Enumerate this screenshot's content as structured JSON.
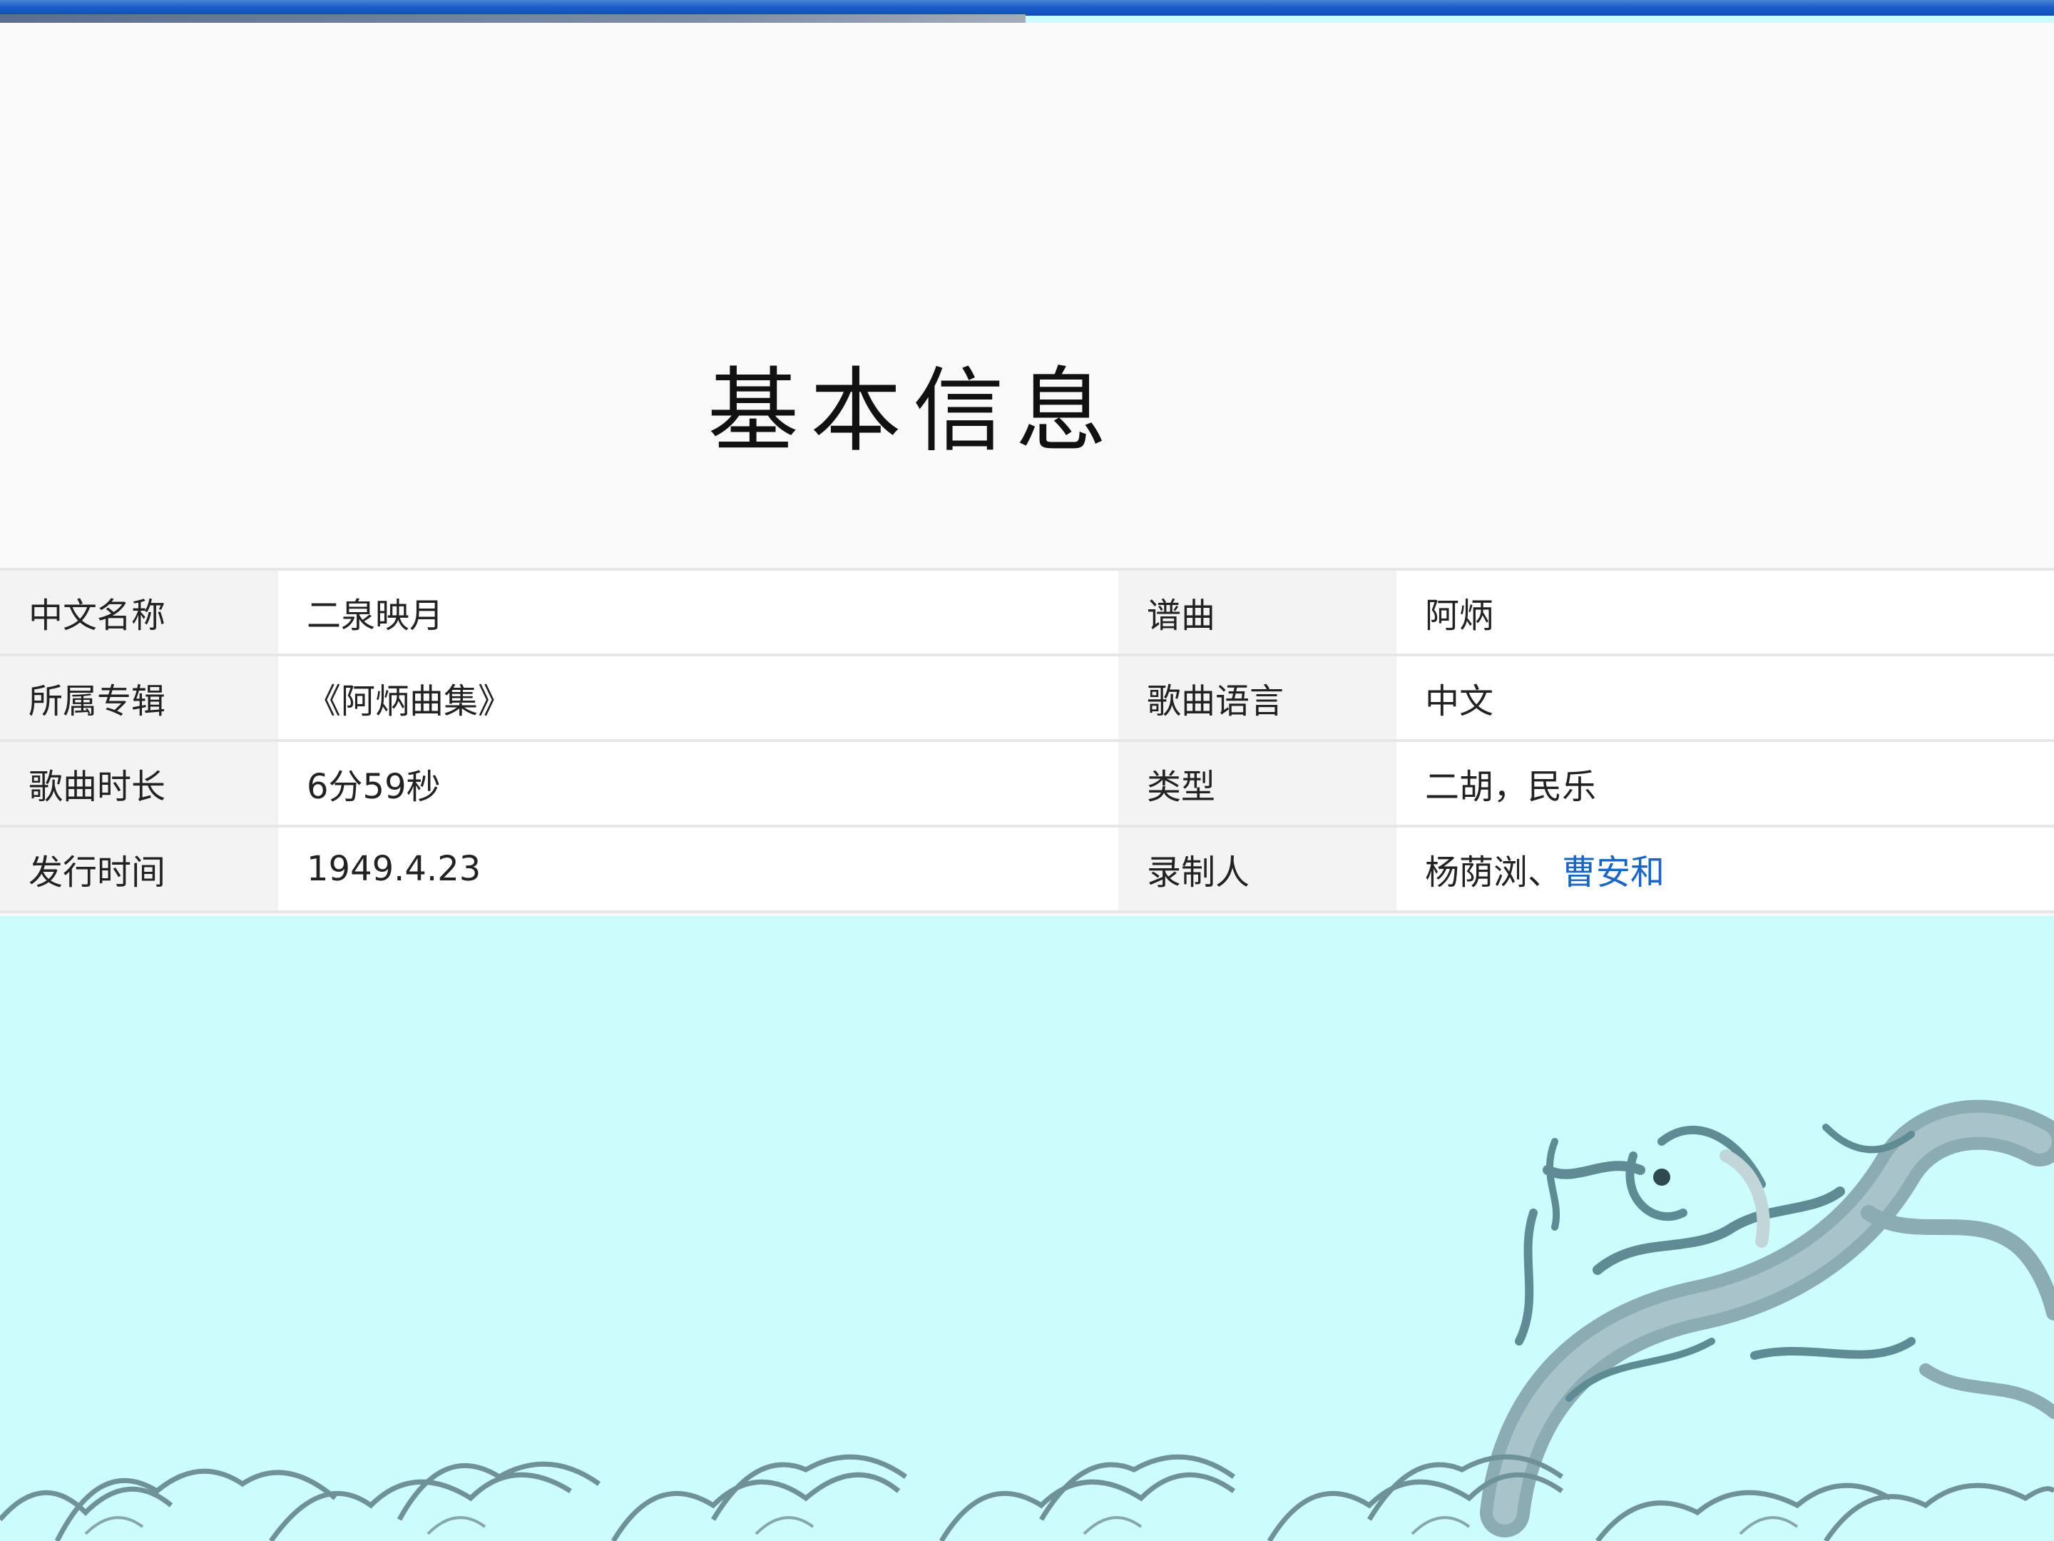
{
  "title": "基本信息",
  "info": {
    "rows": [
      {
        "left_label": "中文名称",
        "left_value": "二泉映月",
        "right_label": "谱曲",
        "right_value": "阿炳"
      },
      {
        "left_label": "所属专辑",
        "left_value": "《阿炳曲集》",
        "right_label": "歌曲语言",
        "right_value": "中文"
      },
      {
        "left_label": "歌曲时长",
        "left_value": "6分59秒",
        "right_label": "类型",
        "right_value": "二胡，民乐"
      },
      {
        "left_label": "发行时间",
        "left_value": "1949.4.23",
        "right_label": "录制人",
        "right_value_plain": "杨荫浏、",
        "right_value_link": "曹安和"
      }
    ]
  },
  "colors": {
    "top_bar": "#1a5fc8",
    "background": "#ccfcfc",
    "link": "#1a66c0"
  },
  "decorations": [
    "wave-pattern",
    "dragon-ornament"
  ]
}
